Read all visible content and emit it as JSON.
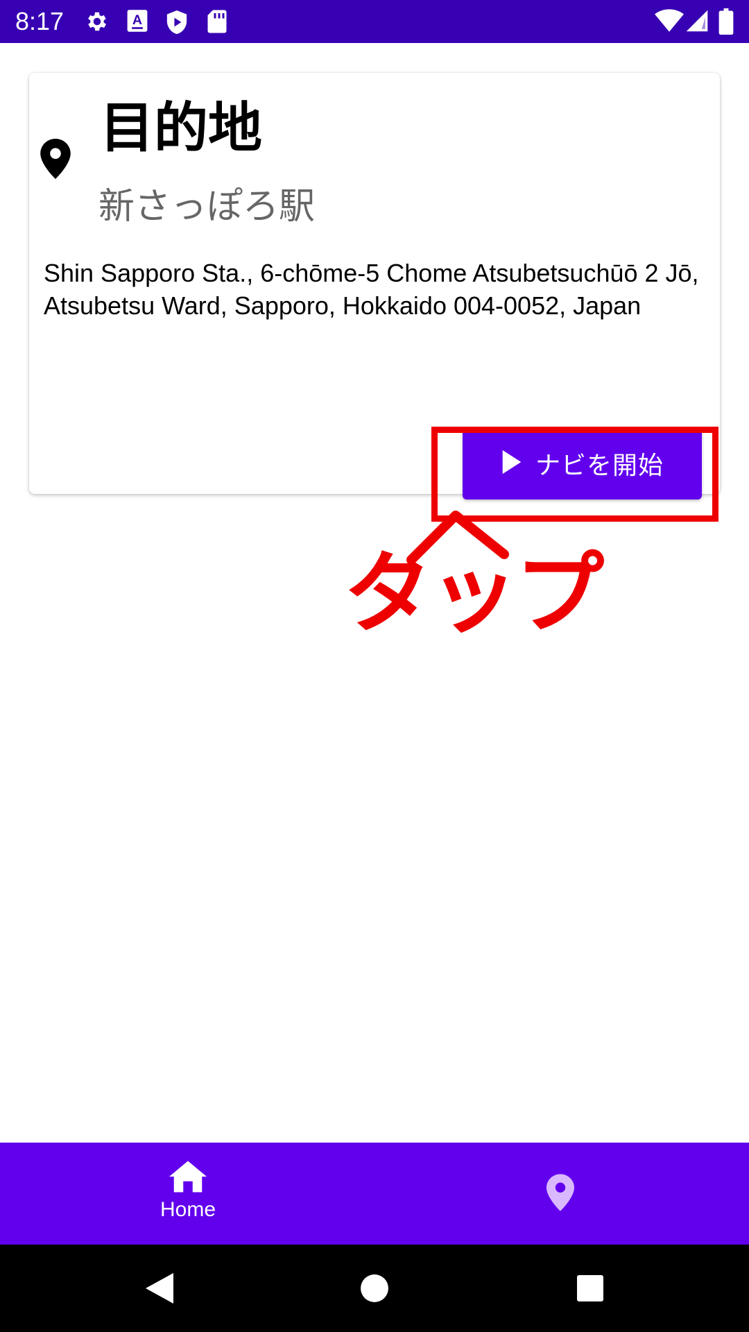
{
  "status_bar": {
    "time": "8:17",
    "background": "#3700b3",
    "icons_left": [
      "settings-icon",
      "keyboard-a-icon",
      "shield-play-icon",
      "sd-card-icon"
    ],
    "icons_right": [
      "wifi-icon",
      "signal-icon",
      "battery-icon"
    ]
  },
  "card": {
    "title": "目的地",
    "subtitle": "新さっぽろ駅",
    "address": "Shin Sapporo Sta., 6-chōme-5 Chome Atsubetsuchūō 2 Jō, Atsubetsu Ward, Sapporo, Hokkaido 004-0052, Japan",
    "icon": "location-pin-icon",
    "nav_button_label": "ナビを開始",
    "nav_button_icon": "play-icon"
  },
  "annotation": {
    "label": "タップ",
    "color": "#ee0000"
  },
  "bottom_nav": {
    "background": "#6200ee",
    "items": [
      {
        "label": "Home",
        "icon": "home-icon",
        "selected": true
      },
      {
        "label": "",
        "icon": "location-pin-icon",
        "selected": false
      }
    ]
  },
  "system_nav": {
    "buttons": [
      "back-icon",
      "home-circle-icon",
      "recents-icon"
    ]
  }
}
